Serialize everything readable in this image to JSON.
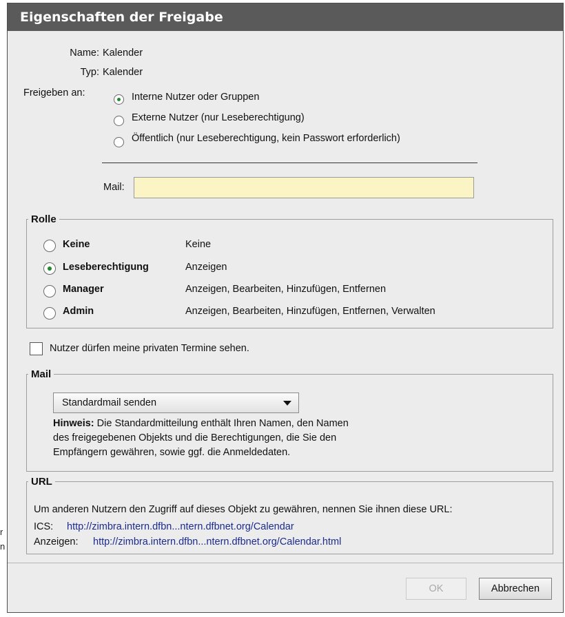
{
  "background": {
    "fragment_1": "r",
    "fragment_2": "n"
  },
  "dialog": {
    "title": "Eigenschaften der Freigabe",
    "name_label": "Name:",
    "name_value": "Kalender",
    "type_label": "Typ:",
    "type_value": "Kalender",
    "share_with_label": "Freigeben an:",
    "share_options": [
      {
        "label": "Interne Nutzer oder Gruppen",
        "checked": true
      },
      {
        "label": "Externe Nutzer (nur Leseberechtigung)",
        "checked": false
      },
      {
        "label": "Öffentlich (nur Leseberechtigung, kein Passwort erforderlich)",
        "checked": false
      }
    ],
    "mail_label": "Mail:",
    "mail_value": "",
    "role": {
      "legend": "Rolle",
      "options": [
        {
          "name": "Keine",
          "description": "Keine",
          "checked": false
        },
        {
          "name": "Leseberechtigung",
          "description": "Anzeigen",
          "checked": true
        },
        {
          "name": "Manager",
          "description": "Anzeigen, Bearbeiten, Hinzufügen, Entfernen",
          "checked": false
        },
        {
          "name": "Admin",
          "description": "Anzeigen, Bearbeiten, Hinzufügen, Entfernen, Verwalten",
          "checked": false
        }
      ]
    },
    "private_checkbox": {
      "label": "Nutzer dürfen meine privaten Termine sehen.",
      "checked": false
    },
    "mail_group": {
      "legend": "Mail",
      "select_value": "Standardmail senden",
      "note_label": "Hinweis:",
      "note_line_1": " Die Standardmitteilung enthält Ihren Namen, den Namen",
      "note_line_2": "des freigegebenen Objekts und die Berechtigungen, die Sie den",
      "note_line_3": "Empfängern gewähren, sowie ggf. die Anmeldedaten."
    },
    "url_group": {
      "legend": "URL",
      "description": "Um anderen Nutzern den Zugriff auf dieses Objekt zu gewähren, nennen Sie ihnen diese URL:",
      "ics_label": "ICS:",
      "ics_url": "http://zimbra.intern.dfbn...ntern.dfbnet.org/Calendar",
      "view_label": "Anzeigen:",
      "view_url": "http://zimbra.intern.dfbn...ntern.dfbnet.org/Calendar.html"
    },
    "buttons": {
      "ok": "OK",
      "cancel": "Abbrechen"
    },
    "colors": {
      "title_bar": "#5a5a5a",
      "mail_field": "#fbf4c4",
      "radio_selected": "#1f8a2b",
      "link": "#1b2b8e"
    }
  }
}
